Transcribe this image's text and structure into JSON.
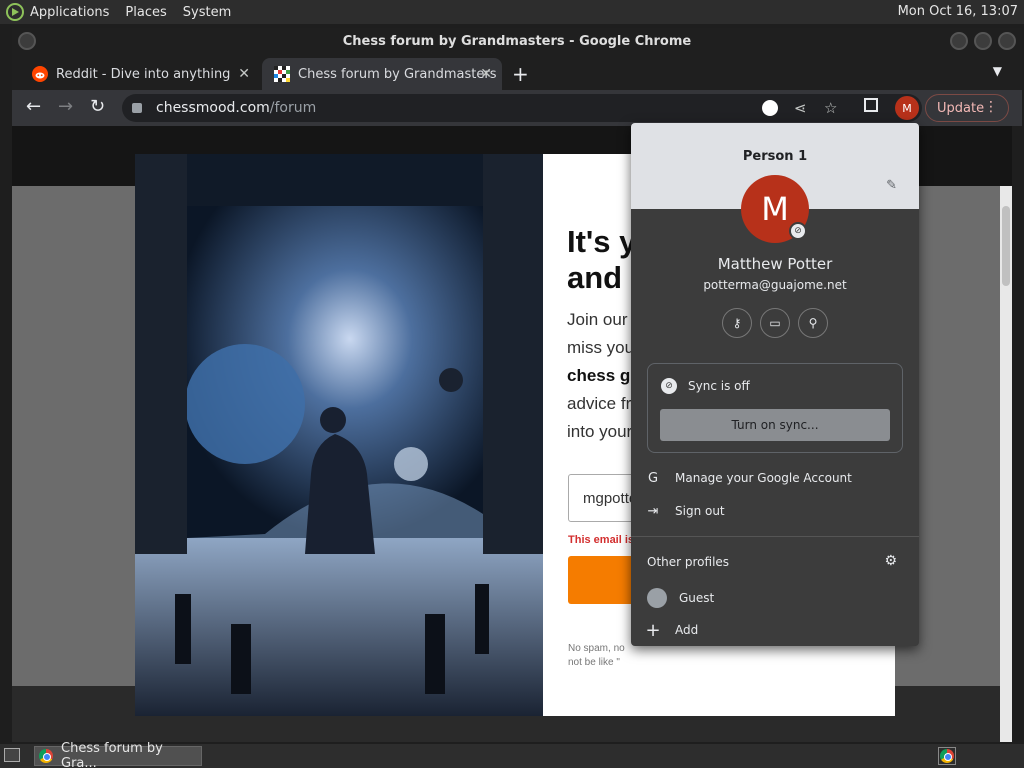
{
  "top_panel": {
    "menus": [
      "Applications",
      "Places",
      "System"
    ],
    "clock": "Mon Oct 16, 13:07"
  },
  "window": {
    "title": "Chess forum by Grandmasters - Google Chrome"
  },
  "tabs": [
    {
      "label": "Reddit - Dive into anything",
      "favicon": "reddit-icon"
    },
    {
      "label": "Chess forum by Grandmasters",
      "favicon": "chessmood-icon",
      "active": true
    }
  ],
  "toolbar": {
    "url_domain": "chessmood.com",
    "url_path": "/forum",
    "profile_initial": "M",
    "update_label": "Update"
  },
  "modal": {
    "headline_line1": "It's y",
    "headline_line2": "and y",
    "body_line1": "Join our",
    "body_line2": "miss you",
    "body_bold": "chess gr",
    "body_line4": "advice fr",
    "body_line5": "into your",
    "email_value": "mgpotte",
    "error_text": "This email is",
    "fineprint_line1": "No spam, no",
    "fineprint_line2": "not be like \""
  },
  "profile_menu": {
    "profile_label": "Person 1",
    "avatar_initial": "M",
    "full_name": "Matthew Potter",
    "email": "potterma@guajome.net",
    "sync_status": "Sync is off",
    "sync_button": "Turn on sync...",
    "manage_account": "Manage your Google Account",
    "sign_out": "Sign out",
    "other_profiles": "Other profiles",
    "guest": "Guest",
    "add": "Add"
  },
  "taskbar": {
    "task_label": "Chess forum by Gra..."
  }
}
